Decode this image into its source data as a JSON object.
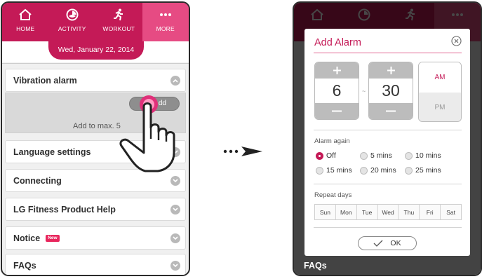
{
  "nav": {
    "tabs": [
      {
        "label": "HOME",
        "icon": "home-icon"
      },
      {
        "label": "ACTIVITY",
        "icon": "activity-icon"
      },
      {
        "label": "WORKOUT",
        "icon": "runner-icon"
      },
      {
        "label": "MORE",
        "icon": "more-dots-icon"
      }
    ],
    "active_tab": "MORE"
  },
  "date": "Wed, January 22, 2014",
  "settings": {
    "vibration_alarm": "Vibration alarm",
    "add_button": "Add",
    "add_button_visible": "dd",
    "add_hint": "Add to max. 5",
    "language_settings": "Language settings",
    "connecting": "Connecting",
    "product_help": "LG Fitness Product Help",
    "notice": "Notice",
    "notice_badge": "New",
    "faqs": "FAQs"
  },
  "dialog": {
    "title": "Add Alarm",
    "hour": "6",
    "separator": "~",
    "minute": "30",
    "am": "AM",
    "pm": "PM",
    "selected_period": "AM",
    "alarm_again_label": "Alarm again",
    "alarm_again_options": [
      "Off",
      "5 mins",
      "10 mins",
      "15 mins",
      "20 mins",
      "25 mins"
    ],
    "alarm_again_selected": "Off",
    "repeat_days_label": "Repeat days",
    "days": [
      "Sun",
      "Mon",
      "Tue",
      "Wed",
      "Thu",
      "Fri",
      "Sat"
    ],
    "ok": "OK"
  },
  "background": {
    "faqs": "FAQs"
  },
  "colors": {
    "brand": "#c41a57",
    "brand_light": "#e64b83",
    "touch": "#e0307a",
    "badge": "#e8265d"
  }
}
